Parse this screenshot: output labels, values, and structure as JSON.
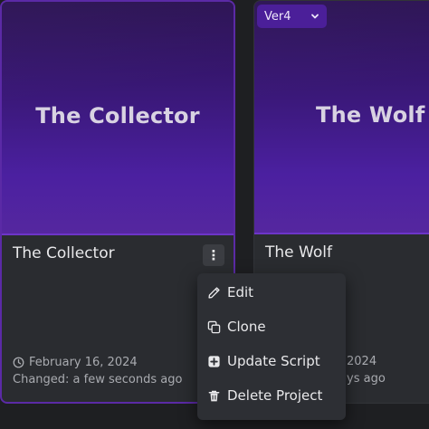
{
  "cards": [
    {
      "thumbnail_title": "The Collector",
      "name": "The Collector",
      "created_date": "February 16, 2024",
      "changed": "Changed: a few seconds ago",
      "menu_button_glyph": "⋮"
    },
    {
      "thumbnail_title": "The Wolf",
      "name": "The Wolf",
      "created_date_partial": "2024",
      "changed_partial": "ys ago"
    }
  ],
  "version_select": {
    "selected": "Ver4"
  },
  "context_menu": {
    "items": [
      {
        "label": "Edit",
        "icon": "pencil-icon"
      },
      {
        "label": "Clone",
        "icon": "copy-icon"
      },
      {
        "label": "Update Script",
        "icon": "plus-square-icon"
      },
      {
        "label": "Delete Project",
        "icon": "trash-icon"
      }
    ]
  },
  "colors": {
    "accent": "#5b2aa6",
    "thumbnail_purple": "#4b20a0",
    "card_bg": "#2a2c30",
    "menu_bg": "#2d2f34"
  }
}
